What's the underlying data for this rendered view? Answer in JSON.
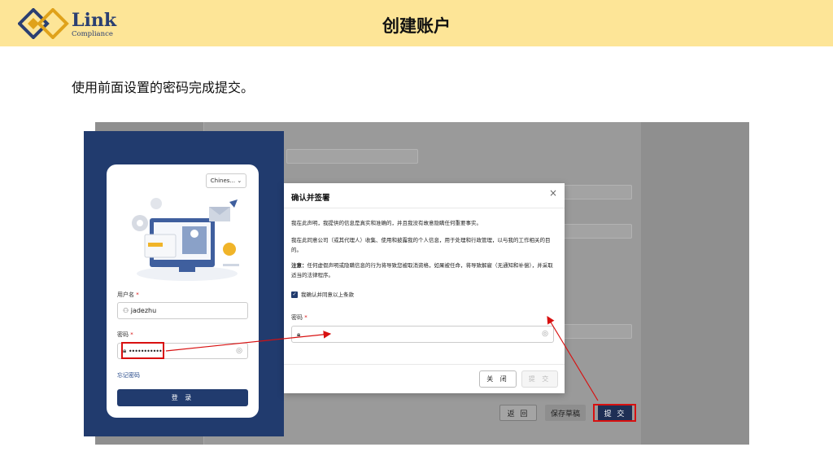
{
  "brand": {
    "name": "Link",
    "sub": "Compliance"
  },
  "slide": {
    "title": "创建账户",
    "instruction": "使用前面设置的密码完成提交。"
  },
  "login": {
    "language": "Chines...",
    "username_label": "用户名",
    "username_value": "jadezhu",
    "password_label": "密码",
    "password_value": "••••••••••••",
    "required_mark": "*",
    "forgot": "忘记密码",
    "login_button": "登 录"
  },
  "modal": {
    "title": "确认并签署",
    "close_glyph": "×",
    "para1": "我在此声明，我提供的信息是真实和准确的，并且我没有故意隐瞒任何重要事实。",
    "para2": "我在此同意公司（或其代理人）收集、使用和披露我的个人信息，用于处理和行政管理，以与我的工作相关的目的。",
    "para3_bold": "注意：",
    "para3": "任何虚假声明或隐瞒信息的行为将导致您被取消资格，如果被任命，将导致解雇（无通知和补偿），并采取适当的法律程序。",
    "agree_label": "我确认并同意以上条款",
    "password_label": "密码",
    "required_mark": "*",
    "close_button": "关 闭",
    "submit_button": "提 交"
  },
  "background_app": {
    "back_button": "返 回",
    "draft_button": "保存草稿",
    "submit_button": "提 交"
  },
  "colors": {
    "header": "#fde597",
    "navy": "#213b6e",
    "red": "#d81010"
  }
}
